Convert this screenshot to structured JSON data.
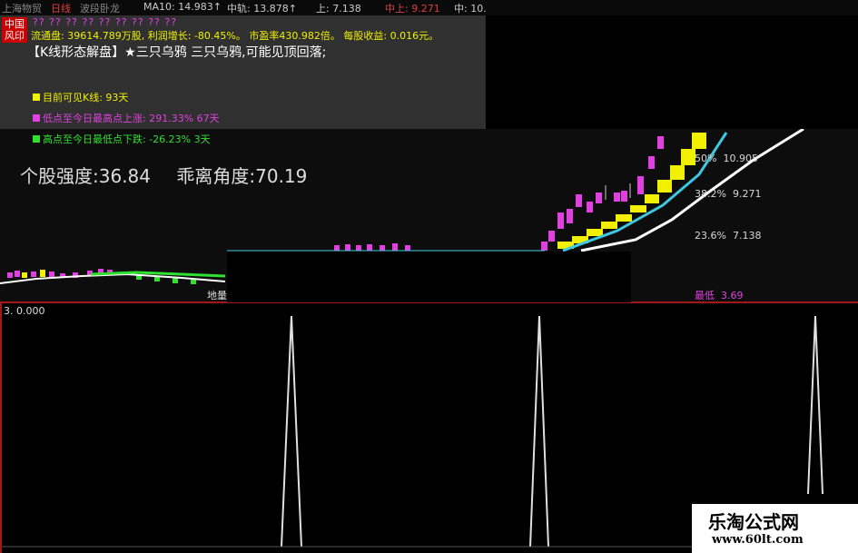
{
  "topbar": {
    "stock": "上海物贸",
    "period": "日线",
    "indicator": "波段卧龙",
    "ma10": "MA10: 14.983↑",
    "mid_track": "中轨: 13.878↑",
    "upper": "上: 7.138",
    "mid_upper": "中上: 9.271",
    "mid": "中: 10."
  },
  "logo": {
    "line1": "中国",
    "line2": "风印"
  },
  "info": {
    "pink_row": "?? ?? ?? ?? ?? ?? ?? ?? ??",
    "float_shares_label": "流通盘:",
    "float_shares": "39614.789万股",
    "profit_growth_label": "利润增长:",
    "profit_growth": "-80.45%",
    "pe_label": "市盈率",
    "pe": "430.982倍",
    "eps_label": "每股收益:",
    "eps": "0.016元",
    "pattern": "【K线形态解盘】★三只乌鸦 三只乌鸦,可能见顶回落;",
    "visible_k_label": "目前可见K线:",
    "visible_k": "93天",
    "low_to_high_label": "低点至今日最高点上涨:",
    "low_to_high": "291.33% 67天",
    "high_to_low_label": "高点至今日最低点下跌:",
    "high_to_low": "-26.23% 3天",
    "strength_label": "个股强度:",
    "strength": "36.84",
    "angle_label": "乖离角度:",
    "angle": "70.19"
  },
  "fib_levels": [
    {
      "pct": "50%",
      "price": "10.905"
    },
    {
      "pct": "38.2%",
      "price": "9.271"
    },
    {
      "pct": "23.6%",
      "price": "7.138"
    }
  ],
  "low_label": {
    "text": "最低",
    "value": "3.69"
  },
  "ground_label": "地量",
  "lower_panel": {
    "value": "3. 0.000"
  },
  "watermark": {
    "title": "乐淘公式网",
    "url": "www.60lt.com"
  },
  "colors": {
    "yellow": "#f0f000",
    "pink": "#e040e0",
    "green": "#30e030",
    "cyan": "#40c8e0",
    "red": "#a01818"
  }
}
